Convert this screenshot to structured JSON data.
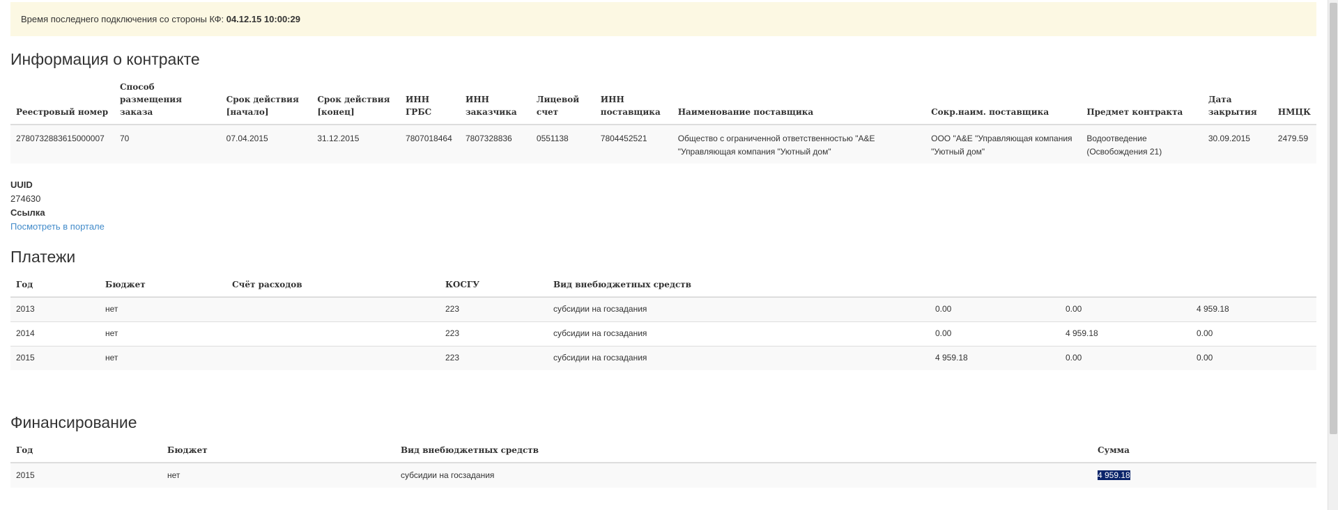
{
  "notice": {
    "text": "Время последнего подключения со стороны КФ: ",
    "datetime": "04.12.15 10:00:29"
  },
  "contract": {
    "title": "Информация о контракте",
    "headers": [
      "Реестровый номер",
      "Способ размещения заказа",
      "Срок действия [начало]",
      "Срок действия [конец]",
      "ИНН ГРБС",
      "ИНН заказчика",
      "Лицевой счет",
      "ИНН поставщика",
      "Наименование поставщика",
      "Сокр.наим. поставщика",
      "Предмет контракта",
      "Дата закрытия",
      "НМЦК"
    ],
    "row": [
      "2780732883615000007",
      "70",
      "07.04.2015",
      "31.12.2015",
      "7807018464",
      "7807328836",
      "0551138",
      "7804452521",
      "Общество с ограниченной ответственностью \"А&Е \"Управляющая компания \"Уютный дом\"",
      "ООО \"А&Е \"Управляющая компания \"Уютный дом\"",
      "Водоотведение (Освобождения 21)",
      "30.09.2015",
      "2479.59"
    ]
  },
  "uuid": {
    "label": "UUID",
    "value": "274630",
    "link_label": "Ссылка",
    "link_text": "Посмотреть в портале"
  },
  "payments": {
    "title": "Платежи",
    "headers": [
      "Год",
      "Бюджет",
      "Счёт расходов",
      "КОСГУ",
      "Вид внебюджетных средств",
      "",
      "",
      ""
    ],
    "rows": [
      [
        "2013",
        "нет",
        "",
        "223",
        "субсидии на госзадания",
        "0.00",
        "0.00",
        "4 959.18"
      ],
      [
        "2014",
        "нет",
        "",
        "223",
        "субсидии на госзадания",
        "0.00",
        "4 959.18",
        "0.00"
      ],
      [
        "2015",
        "нет",
        "",
        "223",
        "субсидии на госзадания",
        "4 959.18",
        "0.00",
        "0.00"
      ]
    ]
  },
  "financing": {
    "title": "Финансирование",
    "headers": [
      "Год",
      "Бюджет",
      "Вид внебюджетных средств",
      "Сумма"
    ],
    "row": [
      "2015",
      "нет",
      "субсидии на госзадания",
      "4 959.18"
    ]
  }
}
